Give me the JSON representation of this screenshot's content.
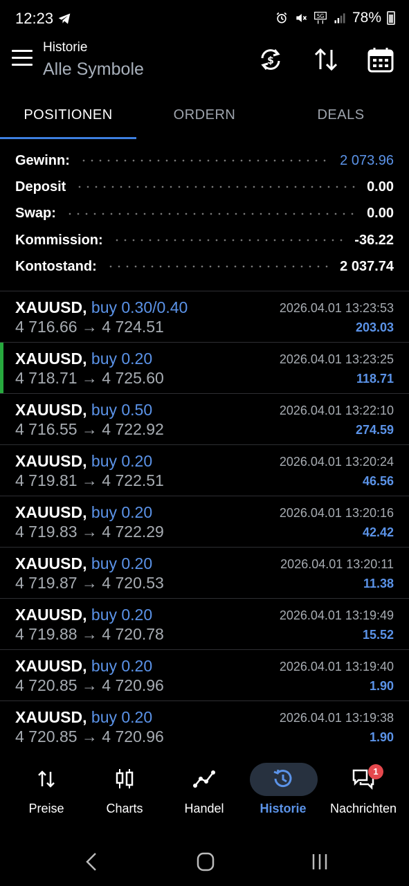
{
  "status_bar": {
    "time": "12:23",
    "battery": "78%",
    "icons": [
      "telegram-icon",
      "alarm-icon",
      "mute-icon",
      "5g-icon",
      "signal-icon",
      "battery-icon"
    ]
  },
  "header": {
    "title": "Historie",
    "subtitle": "Alle Symbole",
    "icons": [
      "refresh-icon",
      "sort-icon",
      "calendar-icon"
    ]
  },
  "tabs": [
    {
      "label": "POSITIONEN",
      "active": true
    },
    {
      "label": "ORDERN",
      "active": false
    },
    {
      "label": "DEALS",
      "active": false
    }
  ],
  "summary": [
    {
      "label": "Gewinn:",
      "value": "2 073.96",
      "highlight": true
    },
    {
      "label": "Deposit",
      "value": "0.00",
      "highlight": false
    },
    {
      "label": "Swap:",
      "value": "0.00",
      "highlight": false
    },
    {
      "label": "Kommission:",
      "value": "-36.22",
      "highlight": false
    },
    {
      "label": "Kontostand:",
      "value": "2 037.74",
      "highlight": false
    }
  ],
  "positions": [
    {
      "symbol": "XAUUSD,",
      "type": "buy 0.30/0.40",
      "prices": "4 716.66 → 4 724.51",
      "datetime": "2026.04.01 13:23:53",
      "profit": "203.03",
      "marked": false
    },
    {
      "symbol": "XAUUSD,",
      "type": "buy 0.20",
      "prices": "4 718.71 → 4 725.60",
      "datetime": "2026.04.01 13:23:25",
      "profit": "118.71",
      "marked": true
    },
    {
      "symbol": "XAUUSD,",
      "type": "buy 0.50",
      "prices": "4 716.55 → 4 722.92",
      "datetime": "2026.04.01 13:22:10",
      "profit": "274.59",
      "marked": false
    },
    {
      "symbol": "XAUUSD,",
      "type": "buy 0.20",
      "prices": "4 719.81 → 4 722.51",
      "datetime": "2026.04.01 13:20:24",
      "profit": "46.56",
      "marked": false
    },
    {
      "symbol": "XAUUSD,",
      "type": "buy 0.20",
      "prices": "4 719.83 → 4 722.29",
      "datetime": "2026.04.01 13:20:16",
      "profit": "42.42",
      "marked": false
    },
    {
      "symbol": "XAUUSD,",
      "type": "buy 0.20",
      "prices": "4 719.87 → 4 720.53",
      "datetime": "2026.04.01 13:20:11",
      "profit": "11.38",
      "marked": false
    },
    {
      "symbol": "XAUUSD,",
      "type": "buy 0.20",
      "prices": "4 719.88 → 4 720.78",
      "datetime": "2026.04.01 13:19:49",
      "profit": "15.52",
      "marked": false
    },
    {
      "symbol": "XAUUSD,",
      "type": "buy 0.20",
      "prices": "4 720.85 → 4 720.96",
      "datetime": "2026.04.01 13:19:40",
      "profit": "1.90",
      "marked": false
    },
    {
      "symbol": "XAUUSD,",
      "type": "buy 0.20",
      "prices": "4 720.85 → 4 720.96",
      "datetime": "2026.04.01 13:19:38",
      "profit": "1.90",
      "marked": false
    }
  ],
  "bottom_nav": [
    {
      "label": "Preise",
      "icon": "quotes-arrows-icon",
      "active": false
    },
    {
      "label": "Charts",
      "icon": "candlestick-icon",
      "active": false
    },
    {
      "label": "Handel",
      "icon": "trade-line-icon",
      "active": false
    },
    {
      "label": "Historie",
      "icon": "history-clock-icon",
      "active": true
    },
    {
      "label": "Nachrichten",
      "icon": "messages-icon",
      "active": false,
      "badge": "1"
    }
  ],
  "colors": {
    "accent": "#5b93e8",
    "tab_indicator": "#3d7fe0",
    "marker_green": "#27a93e",
    "badge_red": "#e5484d",
    "background": "#000000"
  }
}
